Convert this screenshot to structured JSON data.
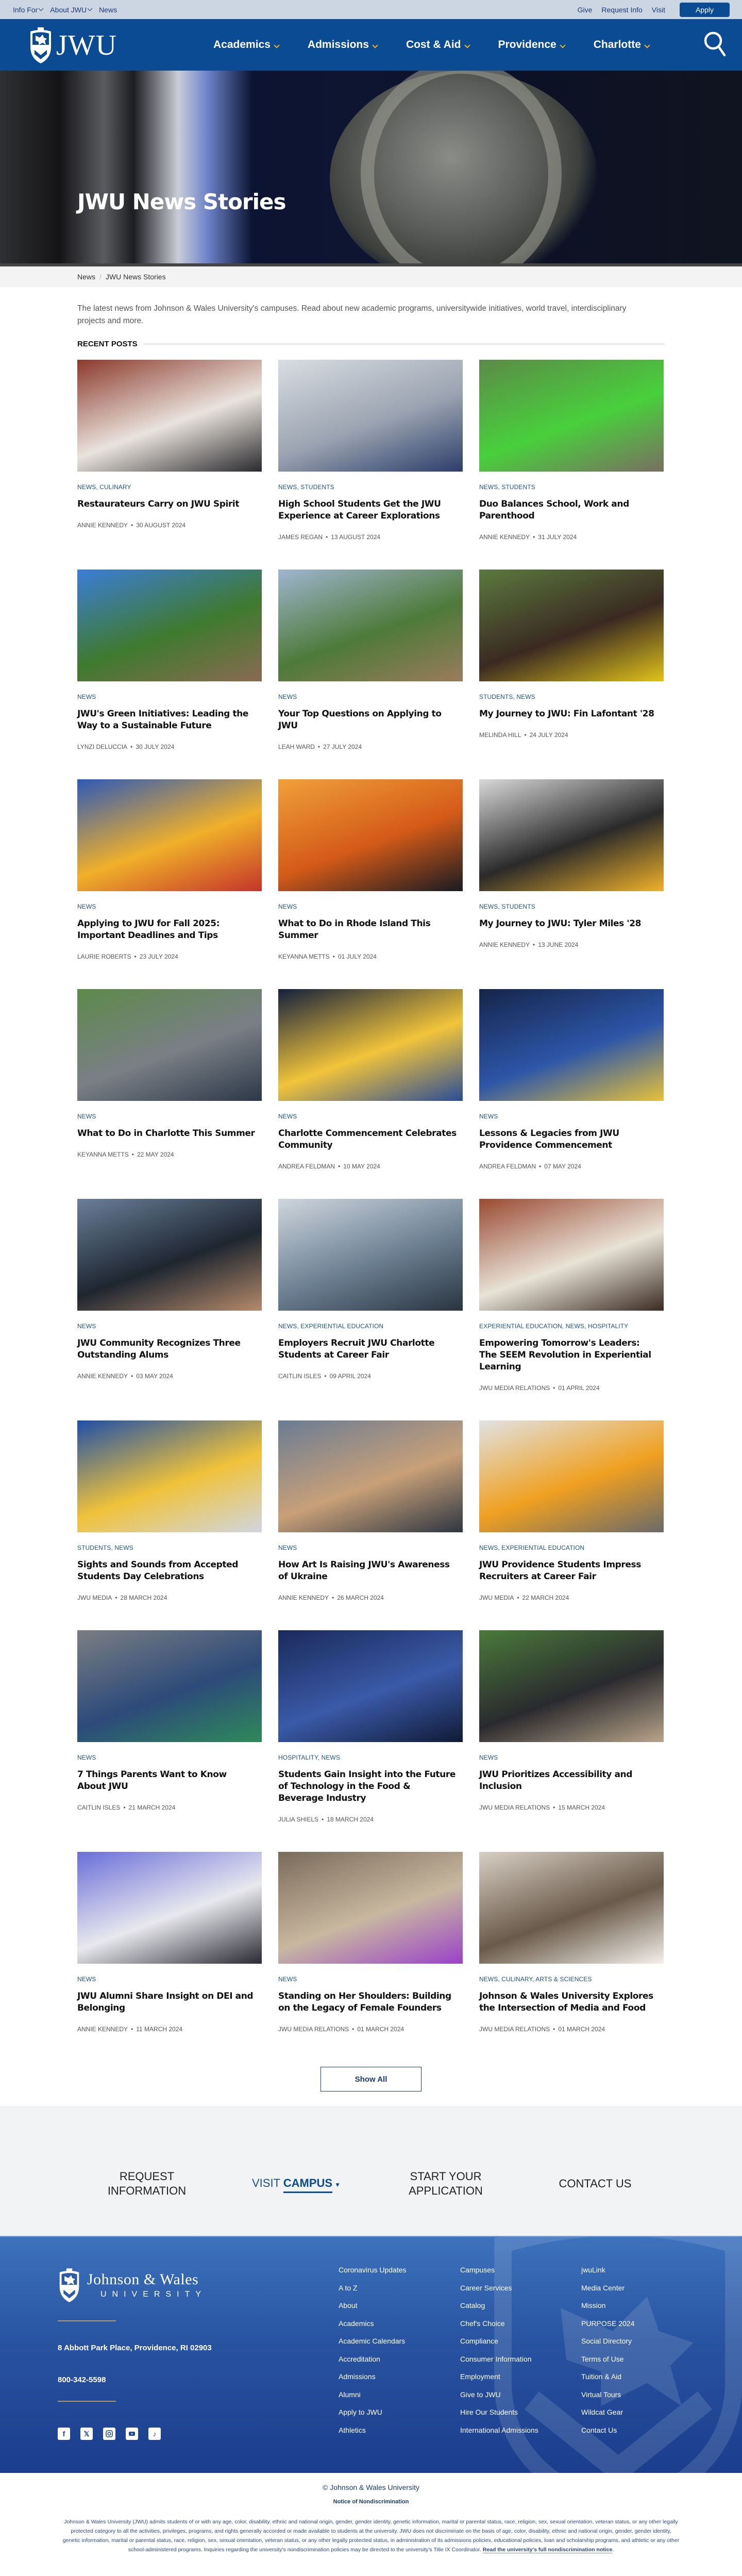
{
  "utility_bar": {
    "left": [
      {
        "label": "Info For",
        "dropdown": true
      },
      {
        "label": "About JWU",
        "dropdown": true
      },
      {
        "label": "News",
        "dropdown": false
      }
    ],
    "right": [
      "Give",
      "Request Info",
      "Visit"
    ],
    "apply_label": "Apply"
  },
  "header": {
    "logo_text": "JWU",
    "nav": [
      "Academics",
      "Admissions",
      "Cost & Aid",
      "Providence",
      "Charlotte"
    ],
    "search_icon": "search-icon",
    "accent_color": "#f5b21b",
    "brand_color": "#0b4b93"
  },
  "hero": {
    "title": "JWU News Stories"
  },
  "breadcrumb": {
    "items": [
      "News",
      "JWU News Stories"
    ],
    "separator": "/"
  },
  "intro": "The latest news from Johnson & Wales University's campuses. Read about new academic programs, universitywide initiatives, world travel, interdisciplinary projects and more.",
  "recent_posts": {
    "heading": "RECENT POSTS",
    "posts": [
      {
        "categories": "News, Culinary",
        "title": "Restaurateurs Carry on JWU Spirit",
        "author": "Annie Kennedy",
        "date": "30 August 2024",
        "thumb": [
          "#8c3a2c",
          "#e9e3dd",
          "#2a2a2e"
        ]
      },
      {
        "categories": "News, Students",
        "title": "High School Students Get the JWU Experience at Career Explorations",
        "author": "James Regan",
        "date": "13 August 2024",
        "thumb": [
          "#d9dde3",
          "#9aa3b0",
          "#2d3e6b"
        ]
      },
      {
        "categories": "News, Students",
        "title": "Duo Balances School, Work and Parenthood",
        "author": "Annie Kennedy",
        "date": "31 July 2024",
        "thumb": [
          "#5c8a48",
          "#48d03c",
          "#7a6e62"
        ]
      },
      {
        "categories": "News",
        "title": "JWU's Green Initiatives: Leading the Way to a Sustainable Future",
        "author": "Lynzi DeLuccia",
        "date": "30 July 2024",
        "thumb": [
          "#3b7dd8",
          "#3f7a2e",
          "#8a6a52"
        ]
      },
      {
        "categories": "News",
        "title": "Your Top Questions on Applying to JWU",
        "author": "Leah Ward",
        "date": "27 July 2024",
        "thumb": [
          "#9fb5cf",
          "#4e7a3a",
          "#9a7b5c"
        ]
      },
      {
        "categories": "Students, News",
        "title": "My Journey to JWU: Fin Lafontant '28",
        "author": "Melinda Hill",
        "date": "24 July 2024",
        "thumb": [
          "#5b7a3e",
          "#3a2a22",
          "#e0c21a"
        ]
      },
      {
        "categories": "News",
        "title": "Applying to JWU for Fall 2025: Important Deadlines and Tips",
        "author": "Laurie Roberts",
        "date": "23 July 2024",
        "thumb": [
          "#2d59b8",
          "#f0b02a",
          "#c4342a"
        ]
      },
      {
        "categories": "News",
        "title": "What to Do in Rhode Island This Summer",
        "author": "Keyanna Metts",
        "date": "01 July 2024",
        "thumb": [
          "#f0a03a",
          "#d45a18",
          "#1a1a22"
        ]
      },
      {
        "categories": "News, Students",
        "title": "My Journey to JWU: Tyler Miles '28",
        "author": "Annie Kennedy",
        "date": "13 June 2024",
        "thumb": [
          "#d8d8d8",
          "#2a2a2a",
          "#f0b12a"
        ]
      },
      {
        "categories": "News",
        "title": "What to Do in Charlotte This Summer",
        "author": "Keyanna Metts",
        "date": "22 May 2024",
        "thumb": [
          "#5d8a4a",
          "#7a7f86",
          "#2c3848"
        ]
      },
      {
        "categories": "News",
        "title": "Charlotte Commencement Celebrates Community",
        "author": "Andrea Feldman",
        "date": "10 May 2024",
        "thumb": [
          "#14203d",
          "#f2c43a",
          "#2b4d96"
        ]
      },
      {
        "categories": "News",
        "title": "Lessons & Legacies from JWU Providence Commencement",
        "author": "Andrea Feldman",
        "date": "07 May 2024",
        "thumb": [
          "#16254a",
          "#2d56a8",
          "#e6c13a"
        ]
      },
      {
        "categories": "News",
        "title": "JWU Community Recognizes Three Outstanding Alums",
        "author": "Annie Kennedy",
        "date": "03 May 2024",
        "thumb": [
          "#6a7f9a",
          "#1e2630",
          "#b58a6a"
        ]
      },
      {
        "categories": "News, Experiential Education",
        "title": "Employers Recruit JWU Charlotte Students at Career Fair",
        "author": "Caitlin Isles",
        "date": "09 April 2024",
        "thumb": [
          "#cfd6de",
          "#6b7f92",
          "#2a3440"
        ]
      },
      {
        "categories": "Experiential Education, News, Hospitality",
        "title": "Empowering Tomorrow's Leaders: The SEEM Revolution in Experiential Learning",
        "author": "JWU Media Relations",
        "date": "01 April 2024",
        "thumb": [
          "#9a4a32",
          "#e8e2d6",
          "#3a2a22"
        ]
      },
      {
        "categories": "Students, News",
        "title": "Sights and Sounds from Accepted Students Day Celebrations",
        "author": "JWU Media",
        "date": "28 March 2024",
        "thumb": [
          "#1f4fa8",
          "#f0c23a",
          "#d0d6e0"
        ]
      },
      {
        "categories": "News",
        "title": "How Art Is Raising JWU's Awareness of Ukraine",
        "author": "Annie Kennedy",
        "date": "26 March 2024",
        "thumb": [
          "#6a7c94",
          "#c8a078",
          "#2d3642"
        ]
      },
      {
        "categories": "News, Experiential Education",
        "title": "JWU Providence Students Impress Recruiters at Career Fair",
        "author": "JWU Media",
        "date": "22 March 2024",
        "thumb": [
          "#e0e2e4",
          "#f0a020",
          "#6a6a6a"
        ]
      },
      {
        "categories": "News",
        "title": "7 Things Parents Want to Know About JWU",
        "author": "Caitlin Isles",
        "date": "21 March 2024",
        "thumb": [
          "#7a7e82",
          "#2d4a7a",
          "#2e8a5a"
        ]
      },
      {
        "categories": "Hospitality, News",
        "title": "Students Gain Insight into the Future of Technology in the Food & Beverage Industry",
        "author": "Julia Shiels",
        "date": "18 March 2024",
        "thumb": [
          "#1b2a5a",
          "#3a5aa8",
          "#101a36"
        ]
      },
      {
        "categories": "News",
        "title": "JWU Prioritizes Accessibility and Inclusion",
        "author": "JWU Media Relations",
        "date": "15 March 2024",
        "thumb": [
          "#4a7a3a",
          "#2a2a2e",
          "#b8a48a"
        ]
      },
      {
        "categories": "News",
        "title": "JWU Alumni Share Insight on DEI and Belonging",
        "author": "Annie Kennedy",
        "date": "11 March 2024",
        "thumb": [
          "#6a6ed8",
          "#e8e8ee",
          "#2a2a34"
        ]
      },
      {
        "categories": "News",
        "title": "Standing on Her Shoulders: Building on the Legacy of Female Founders",
        "author": "JWU Media Relations",
        "date": "01 March 2024",
        "thumb": [
          "#7a6a5a",
          "#c8b8a0",
          "#9a42c8"
        ]
      },
      {
        "categories": "News, Culinary, Arts & Sciences",
        "title": "Johnson & Wales University Explores the Intersection of Media and Food",
        "author": "JWU Media Relations",
        "date": "01 March 2024",
        "thumb": [
          "#d8cfc4",
          "#6a5a4a",
          "#f4f0ea"
        ]
      }
    ],
    "show_all_label": "Show All"
  },
  "cta": {
    "items": [
      {
        "line1": "Request",
        "line2": "Information"
      },
      {
        "prefix": "Visit",
        "bold": "Campus",
        "dropdown": true
      },
      {
        "line1": "Start Your",
        "line2": "Application"
      },
      {
        "line1": "Contact Us"
      }
    ]
  },
  "footer": {
    "logo_line1": "Johnson & Wales",
    "logo_line2": "UNIVERSITY",
    "address": "8 Abbott Park Place, Providence, RI 02903",
    "phone": "800-342-5598",
    "social": [
      "facebook-icon",
      "x-icon",
      "instagram-icon",
      "youtube-icon",
      "tiktok-icon"
    ],
    "columns": [
      [
        "Coronavirus Updates",
        "A to Z",
        "About",
        "Academics",
        "Academic Calendars",
        "Accreditation",
        "Admissions",
        "Alumni",
        "Apply to JWU",
        "Athletics"
      ],
      [
        "Campuses",
        "Career Services",
        "Catalog",
        "Chef's Choice",
        "Compliance",
        "Consumer Information",
        "Employment",
        "Give to JWU",
        "Hire Our Students",
        "International Admissions"
      ],
      [
        "jwuLink",
        "Media Center",
        "Mission",
        "PURPOSE 2024",
        "Social Directory",
        "Terms of Use",
        "Tuition & Aid",
        "Virtual Tours",
        "Wildcat Gear",
        "Contact Us"
      ]
    ]
  },
  "legal": {
    "copyright": "© Johnson & Wales University",
    "notice_title": "Notice of Nondiscrimination",
    "notice_text": "Johnson & Wales University (JWU) admits students of or with any age, color, disability, ethnic and national origin, gender, gender identity, genetic information, marital or parental status, race, religion, sex, sexual orientation, veteran status, or any other legally protected category to all the activities, privileges, programs, and rights generally accorded or made available to students at the university. JWU does not discriminate on the basis of age, color, disability, ethnic and national origin, gender, gender identity, genetic information, marital or parental status, race, religion, sex, sexual orientation, veteran status, or any other legally protected status, in administration of its admissions policies, educational policies, loan and scholarship programs, and athletic or any other school-administered programs. Inquiries regarding the university's nondiscrimination policies may be directed to the university's Title IX Coordinator.",
    "notice_link": "Read the university's full nondiscrimination notice"
  }
}
